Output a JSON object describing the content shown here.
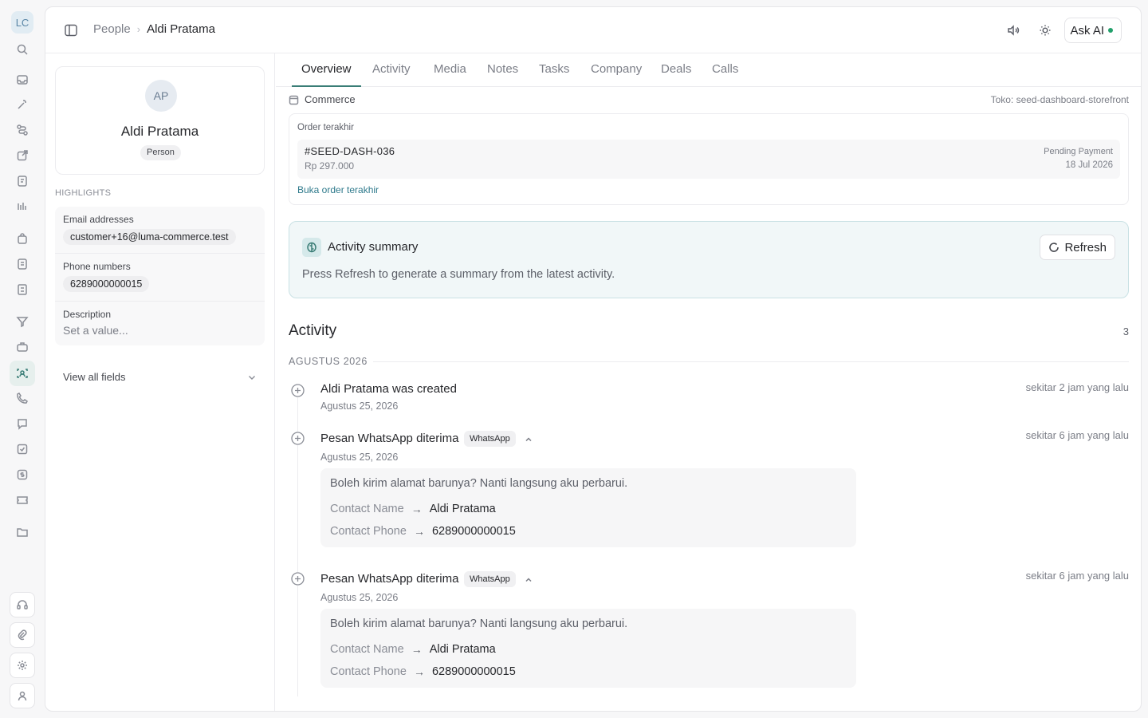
{
  "rail": {
    "logo_text": "LC"
  },
  "header": {
    "breadcrumb_root": "People",
    "breadcrumb_current": "Aldi Pratama",
    "ask_ai_label": "Ask AI"
  },
  "profile": {
    "initials": "AP",
    "name": "Aldi Pratama",
    "type": "Person"
  },
  "highlights": {
    "title": "HIGHLIGHTS",
    "email_label": "Email addresses",
    "email_value": "customer+16@luma-commerce.test",
    "phone_label": "Phone numbers",
    "phone_value": "6289000000015",
    "description_label": "Description",
    "description_placeholder": "Set a value...",
    "view_all": "View all fields"
  },
  "tabs": [
    "Overview",
    "Activity",
    "Media",
    "Notes",
    "Tasks",
    "Company",
    "Deals",
    "Calls"
  ],
  "commerce": {
    "title": "Commerce",
    "store": "Toko: seed-dashboard-storefront",
    "recent_label": "Order terakhir",
    "order_id": "#SEED-DASH-036",
    "order_amount": "Rp 297.000",
    "order_status": "Pending Payment",
    "order_date": "18 Jul 2026",
    "open_link": "Buka order terakhir"
  },
  "summary": {
    "title": "Activity summary",
    "refresh_label": "Refresh",
    "text": "Press Refresh to generate a summary from the latest activity."
  },
  "activity": {
    "title": "Activity",
    "count": "3",
    "month": "AGUSTUS 2026",
    "events": [
      {
        "title": "Aldi Pratama was created",
        "date": "Agustus 25, 2026",
        "ago": "sekitar 2 jam yang lalu"
      },
      {
        "title": "Pesan WhatsApp diterima",
        "badge": "WhatsApp",
        "date": "Agustus 25, 2026",
        "ago": "sekitar 6 jam yang lalu",
        "message": "Boleh kirim alamat barunya? Nanti langsung aku perbarui.",
        "contact_name_label": "Contact Name",
        "contact_name": "Aldi Pratama",
        "contact_phone_label": "Contact Phone",
        "contact_phone": "6289000000015"
      },
      {
        "title": "Pesan WhatsApp diterima",
        "badge": "WhatsApp",
        "date": "Agustus 25, 2026",
        "ago": "sekitar 6 jam yang lalu",
        "message": "Boleh kirim alamat barunya? Nanti langsung aku perbarui.",
        "contact_name_label": "Contact Name",
        "contact_name": "Aldi Pratama",
        "contact_phone_label": "Contact Phone",
        "contact_phone": "6289000000015"
      }
    ]
  }
}
